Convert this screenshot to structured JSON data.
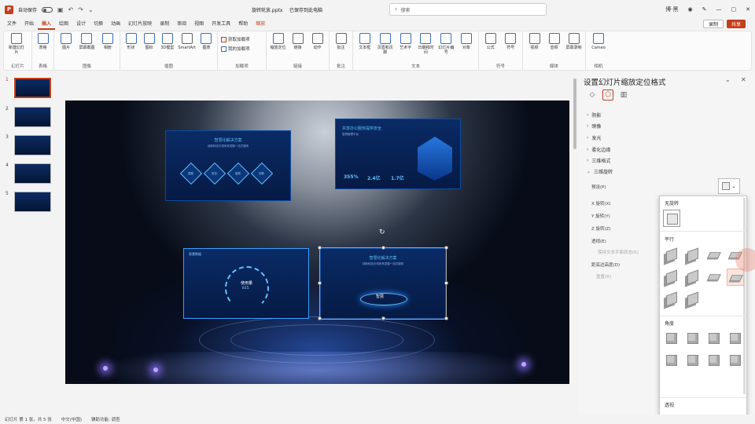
{
  "titlebar": {
    "autosave_label": "自动保存",
    "filename": "旋转轮放.pptx",
    "save_location": "已保存到此电脑",
    "search_placeholder": "搜索",
    "user": "博·黑",
    "app_name_short": "P"
  },
  "menu": {
    "tabs": [
      "文件",
      "开始",
      "插入",
      "绘图",
      "设计",
      "切换",
      "动画",
      "幻灯片放映",
      "录制",
      "审阅",
      "视图",
      "开发工具",
      "帮助",
      "缩放"
    ],
    "active_index": 2,
    "contextual_index": 13,
    "share_label": "共享",
    "comment_label": "录制"
  },
  "ribbon": {
    "groups": [
      {
        "label": "幻灯片",
        "items": [
          "新建幻灯片"
        ]
      },
      {
        "label": "表格",
        "items": [
          "表格"
        ]
      },
      {
        "label": "图像",
        "items": [
          "图片",
          "屏幕截图",
          "相册"
        ]
      },
      {
        "label": "插图",
        "items": [
          "形状",
          "图标",
          "3D模型",
          "SmartArt",
          "图表"
        ]
      },
      {
        "label": "加载项",
        "items_small": [
          "获取加载项",
          "我的加载项"
        ]
      },
      {
        "label": "链接",
        "items": [
          "缩放定位",
          "链接",
          "动作"
        ]
      },
      {
        "label": "批注",
        "items": [
          "批注"
        ]
      },
      {
        "label": "文本",
        "items": [
          "文本框",
          "页眉和页脚",
          "艺术字",
          "日期和时间",
          "幻灯片编号",
          "对象"
        ]
      },
      {
        "label": "符号",
        "items": [
          "公式",
          "符号"
        ]
      },
      {
        "label": "媒体",
        "items": [
          "视频",
          "音频",
          "屏幕录制"
        ]
      },
      {
        "label": "相机",
        "items": [
          "Cameo"
        ]
      }
    ]
  },
  "thumbnails": {
    "numbers": [
      "1",
      "2",
      "3",
      "4",
      "5"
    ],
    "selected_index": 0
  },
  "slide": {
    "tiles": [
      {
        "title": "智慧化解决方案",
        "subtitle": "创新科技引领未来发展一站式服务"
      },
      {
        "title": "共享办公服务提供安全",
        "subtitle": "智慧管理平台",
        "stats": [
          "355%",
          "2.4亿",
          "1.7亿"
        ]
      },
      {
        "title": "智慧数据",
        "gauge_label": "使用量",
        "gauge_value": "815"
      },
      {
        "title": "智慧化解决方案",
        "subtitle": "创新科技引领未来发展一站式服务",
        "center": "智慧"
      }
    ],
    "diamond_labels": [
      "智能",
      "安全",
      "高效",
      "创新"
    ]
  },
  "format_pane": {
    "title": "设置幻灯片缩放定位格式",
    "sections": [
      "阴影",
      "映像",
      "发光",
      "柔化边缘",
      "三维格式",
      "三维旋转"
    ],
    "expanded_section": "三维旋转",
    "rows": {
      "preset": "预设(P)",
      "x_rotation": "X 旋转(X)",
      "y_rotation": "Y 旋转(Y)",
      "z_rotation": "Z 旋转(Z)",
      "perspective": "透视(E)",
      "keep_text_flat": "保持文本平面状态(K)",
      "distance_from_ground": "距底边高度(D)",
      "reset": "重置(R)"
    }
  },
  "rotation_gallery": {
    "headers": [
      "无旋转",
      "平行",
      "角度",
      "透视"
    ],
    "parallel_count": 10,
    "oblique_count": 8,
    "perspective_count": 4,
    "hover_index": 7
  },
  "statusbar": {
    "slide_info": "幻灯片 第 1 张，共 5 张",
    "language": "中文(中国)",
    "accessibility": "辅助功能: 调查"
  },
  "colors": {
    "accent": "#c43e1c",
    "slide_blue": "#0a2b66",
    "tile_title": "#5fc3ff"
  }
}
